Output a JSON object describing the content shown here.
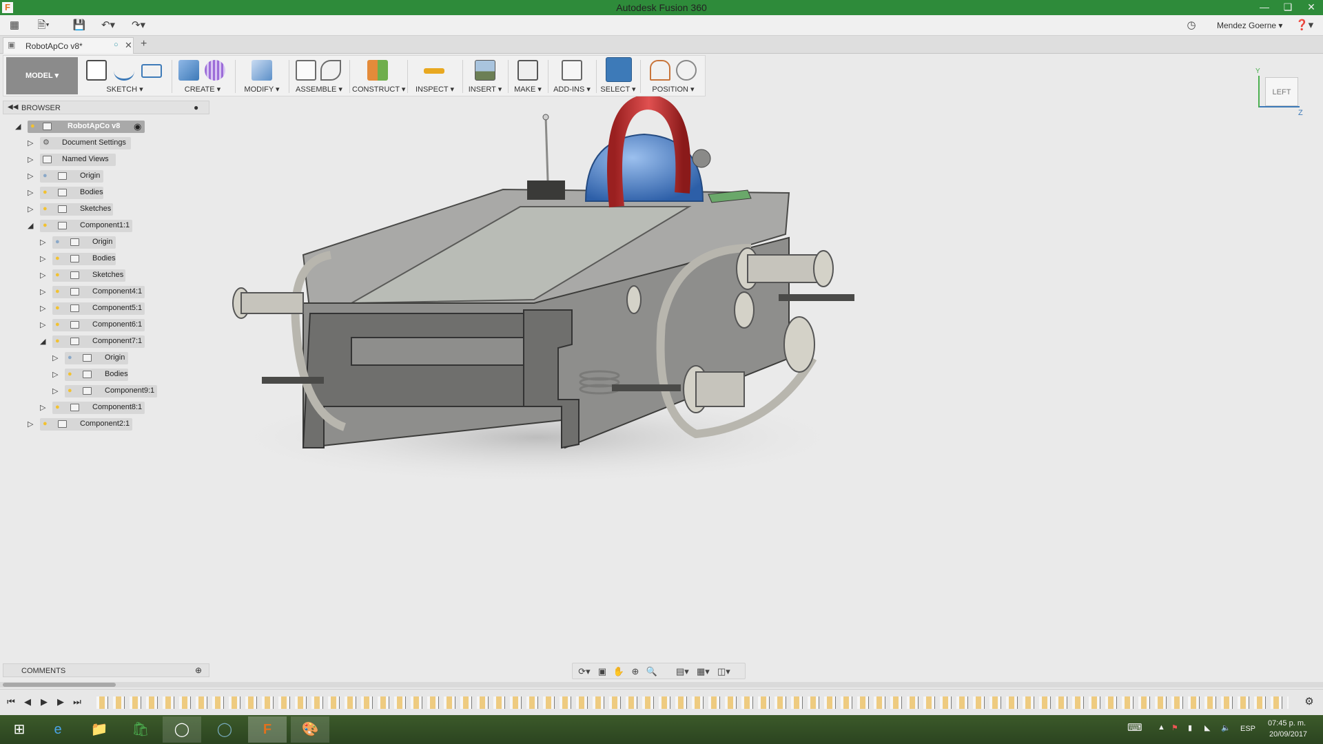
{
  "window": {
    "title": "Autodesk Fusion 360",
    "app_icon": "F"
  },
  "quick_access": {
    "user": "Mendez Goerne"
  },
  "tab": {
    "label": "RobotApCo v8*"
  },
  "ribbon": {
    "workspace": "MODEL",
    "groups": [
      {
        "label": "SKETCH",
        "icon": "sketch-icon"
      },
      {
        "label": "CREATE",
        "icon": "create-icon"
      },
      {
        "label": "MODIFY",
        "icon": "modify-icon"
      },
      {
        "label": "ASSEMBLE",
        "icon": "assemble-icon"
      },
      {
        "label": "CONSTRUCT",
        "icon": "construct-icon"
      },
      {
        "label": "INSPECT",
        "icon": "inspect-icon"
      },
      {
        "label": "INSERT",
        "icon": "insert-icon"
      },
      {
        "label": "MAKE",
        "icon": "make-icon"
      },
      {
        "label": "ADD-INS",
        "icon": "add-ins-icon"
      },
      {
        "label": "SELECT",
        "icon": "select-icon"
      },
      {
        "label": "POSITION",
        "icon": "position-icon"
      }
    ]
  },
  "browser": {
    "title": "BROWSER",
    "items": [
      {
        "label": "RobotApCo v8",
        "expanded": true
      },
      {
        "label": "Document Settings"
      },
      {
        "label": "Named Views"
      },
      {
        "label": "Origin"
      },
      {
        "label": "Bodies"
      },
      {
        "label": "Sketches"
      },
      {
        "label": "Component1:1",
        "expanded": true
      },
      {
        "label": "Origin"
      },
      {
        "label": "Bodies"
      },
      {
        "label": "Sketches"
      },
      {
        "label": "Component4:1"
      },
      {
        "label": "Component5:1"
      },
      {
        "label": "Component6:1"
      },
      {
        "label": "Component7:1",
        "expanded": true
      },
      {
        "label": "Origin"
      },
      {
        "label": "Bodies"
      },
      {
        "label": "Component9:1"
      },
      {
        "label": "Component8:1"
      },
      {
        "label": "Component2:1"
      }
    ]
  },
  "viewcube": {
    "face": "LEFT",
    "axis_y": "Y",
    "axis_z": "Z"
  },
  "comments": {
    "title": "COMMENTS"
  },
  "taskbar": {
    "lang": "ESP",
    "time": "07:45 p. m.",
    "date": "20/09/2017"
  },
  "colors": {
    "titlebar": "#2e8b3a",
    "select_active": "#3d7ab8",
    "accent_red": "#c83a3a",
    "dome_blue": "#3f72b8"
  }
}
